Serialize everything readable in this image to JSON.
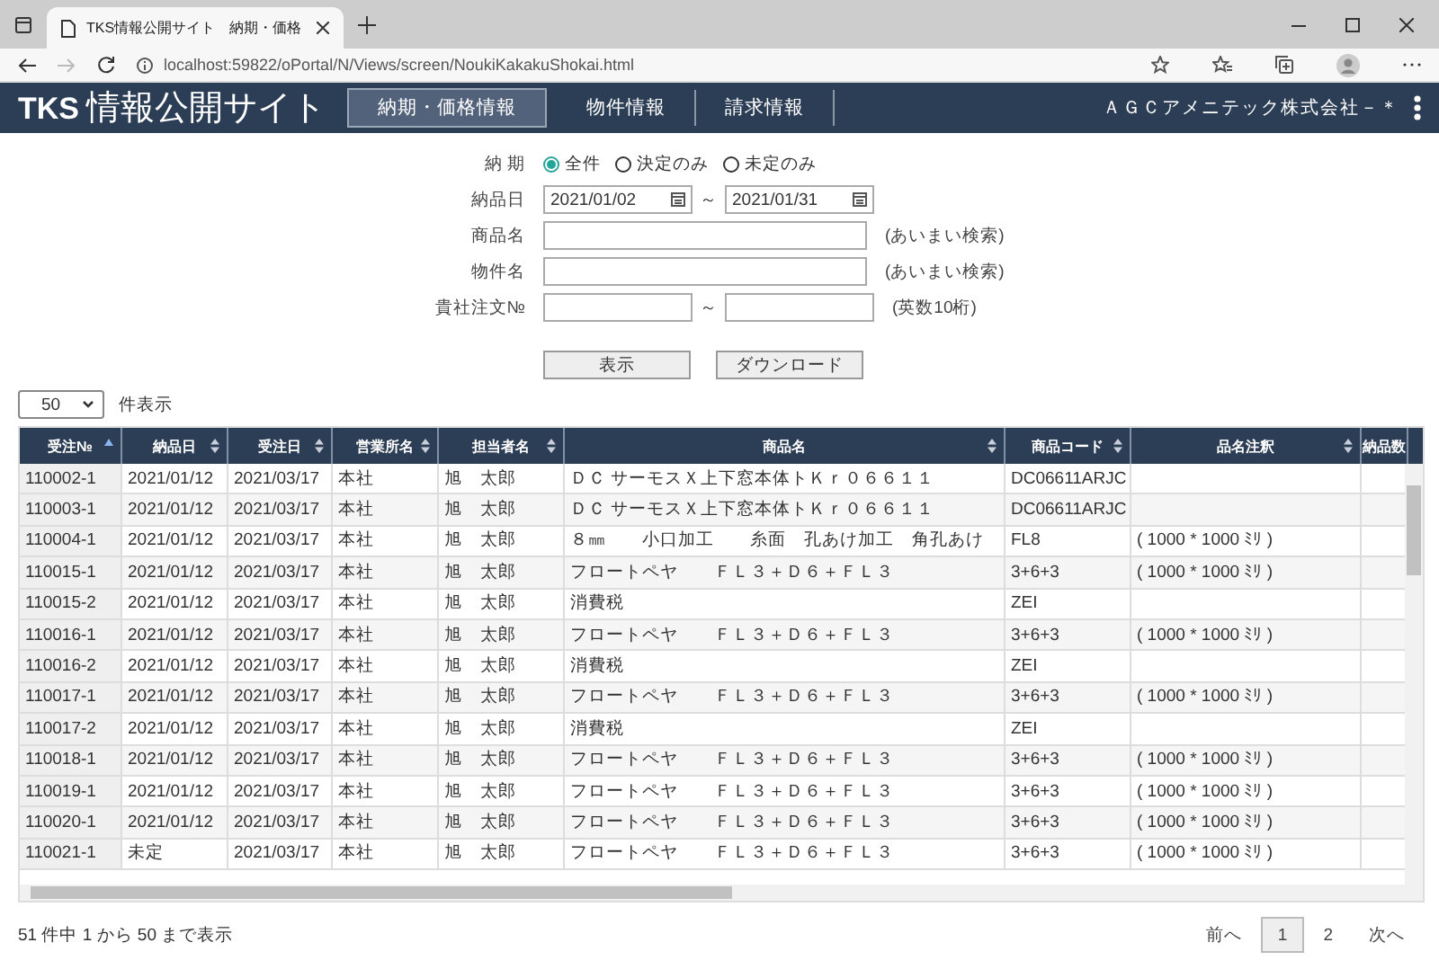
{
  "browser": {
    "tab_title": "TKS情報公開サイト　納期・価格",
    "url": "localhost:59822/oPortal/N/Views/screen/NoukiKakakuShokai.html"
  },
  "nav": {
    "logo_bold": "TKS",
    "logo_text": "情報公開サイト",
    "items": [
      {
        "label": "納期・価格情報",
        "selected": true
      },
      {
        "label": "物件情報",
        "selected": false
      },
      {
        "label": "請求情報",
        "selected": false
      }
    ],
    "company": "ＡＧＣアメニテック株式会社－＊"
  },
  "form": {
    "delivery_label": "納 期",
    "radios": [
      {
        "label": "全件",
        "selected": true
      },
      {
        "label": "決定のみ",
        "selected": false
      },
      {
        "label": "未定のみ",
        "selected": false
      }
    ],
    "date_label": "納品日",
    "date_from": "2021/01/02",
    "range_sep": "～",
    "date_to": "2021/01/31",
    "product_label": "商品名",
    "product_hint": "(あいまい検索)",
    "property_label": "物件名",
    "property_hint": "(あいまい検索)",
    "order_label": "貴社注文№",
    "order_sep": "～",
    "order_hint": "(英数10桁)",
    "buttons": [
      "表示",
      "ダウンロード"
    ]
  },
  "page_size": {
    "value": "50",
    "suffix": "件表示"
  },
  "table": {
    "columns": [
      {
        "label": "受注№",
        "sorted": true
      },
      {
        "label": "納品日",
        "sorted": false
      },
      {
        "label": "受注日",
        "sorted": false
      },
      {
        "label": "営業所名",
        "sorted": false
      },
      {
        "label": "担当者名",
        "sorted": false
      },
      {
        "label": "商品名",
        "sorted": false
      },
      {
        "label": "商品コード",
        "sorted": false
      },
      {
        "label": "品名注釈",
        "sorted": false
      },
      {
        "label": "納品数"
      }
    ],
    "rows": [
      [
        "110002-1",
        "2021/01/12",
        "2021/03/17",
        "本社",
        "旭　太郎",
        "ＤＣ サーモスＸ上下窓本体トＫｒ０６６１１",
        "DC06611ARJC",
        ""
      ],
      [
        "110003-1",
        "2021/01/12",
        "2021/03/17",
        "本社",
        "旭　太郎",
        "ＤＣ サーモスＸ上下窓本体トＫｒ０６６１１",
        "DC06611ARJC",
        ""
      ],
      [
        "110004-1",
        "2021/01/12",
        "2021/03/17",
        "本社",
        "旭　太郎",
        "８㎜　　小口加工　　糸面　孔あけ加工　角孔あけ",
        "FL8",
        "(  1000 *  1000 ﾐﾘ )"
      ],
      [
        "110015-1",
        "2021/01/12",
        "2021/03/17",
        "本社",
        "旭　太郎",
        "フロートペヤ　　ＦＬ３＋Ｄ６＋ＦＬ３",
        "3+6+3",
        "(  1000 *  1000 ﾐﾘ )"
      ],
      [
        "110015-2",
        "2021/01/12",
        "2021/03/17",
        "本社",
        "旭　太郎",
        "消費税",
        "ZEI",
        ""
      ],
      [
        "110016-1",
        "2021/01/12",
        "2021/03/17",
        "本社",
        "旭　太郎",
        "フロートペヤ　　ＦＬ３＋Ｄ６＋ＦＬ３",
        "3+6+3",
        "(  1000 *  1000 ﾐﾘ )"
      ],
      [
        "110016-2",
        "2021/01/12",
        "2021/03/17",
        "本社",
        "旭　太郎",
        "消費税",
        "ZEI",
        ""
      ],
      [
        "110017-1",
        "2021/01/12",
        "2021/03/17",
        "本社",
        "旭　太郎",
        "フロートペヤ　　ＦＬ３＋Ｄ６＋ＦＬ３",
        "3+6+3",
        "(  1000 *  1000 ﾐﾘ )"
      ],
      [
        "110017-2",
        "2021/01/12",
        "2021/03/17",
        "本社",
        "旭　太郎",
        "消費税",
        "ZEI",
        ""
      ],
      [
        "110018-1",
        "2021/01/12",
        "2021/03/17",
        "本社",
        "旭　太郎",
        "フロートペヤ　　ＦＬ３＋Ｄ６＋ＦＬ３",
        "3+6+3",
        "(  1000 *  1000 ﾐﾘ )"
      ],
      [
        "110019-1",
        "2021/01/12",
        "2021/03/17",
        "本社",
        "旭　太郎",
        "フロートペヤ　　ＦＬ３＋Ｄ６＋ＦＬ３",
        "3+6+3",
        "(  1000 *  1000 ﾐﾘ )"
      ],
      [
        "110020-1",
        "2021/01/12",
        "2021/03/17",
        "本社",
        "旭　太郎",
        "フロートペヤ　　ＦＬ３＋Ｄ６＋ＦＬ３",
        "3+6+3",
        "(  1000 *  1000 ﾐﾘ )"
      ],
      [
        "110021-1",
        "未定",
        "2021/03/17",
        "本社",
        "旭　太郎",
        "フロートペヤ　　ＦＬ３＋Ｄ６＋ＦＬ３",
        "3+6+3",
        "(  1000 *  1000 ﾐﾘ )"
      ]
    ]
  },
  "footer": {
    "summary": "51 件中 1 から 50 まで表示",
    "pagination": [
      {
        "label": "前へ",
        "selected": false
      },
      {
        "label": "1",
        "selected": true
      },
      {
        "label": "2",
        "selected": false
      },
      {
        "label": "次へ",
        "selected": false
      }
    ]
  }
}
